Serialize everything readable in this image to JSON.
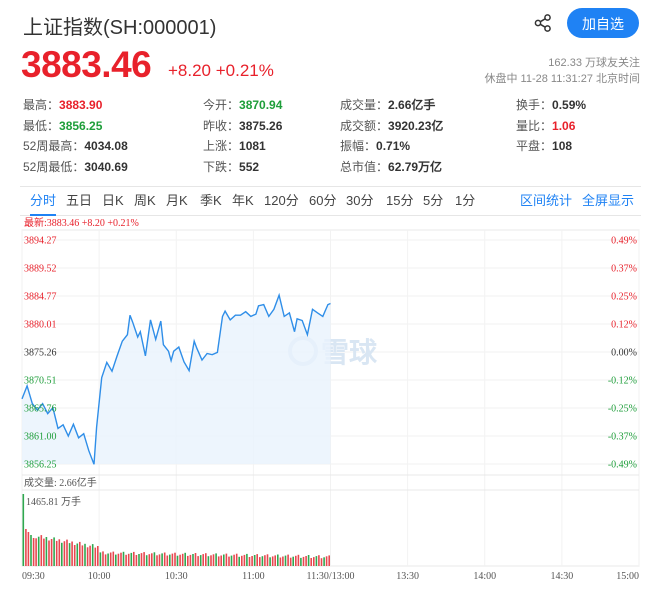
{
  "header": {
    "title": "上证指数(SH:000001)",
    "add_button": "加自选",
    "price": "3883.46",
    "change": "+8.20",
    "change_pct": "+0.21%",
    "followers": "162.33 万球友关注",
    "status": "休盘中 11-28 11:31:27 北京时间"
  },
  "stats": [
    {
      "label": "最高：",
      "value": "3883.90",
      "color": "#e8212b"
    },
    {
      "label": "今开：",
      "value": "3870.94",
      "color": "#1e9e3a"
    },
    {
      "label": "成交量：",
      "value": "2.66亿手",
      "color": "#333333"
    },
    {
      "label": "换手：",
      "value": "0.59%",
      "color": "#333333"
    },
    {
      "label": "最低：",
      "value": "3856.25",
      "color": "#1e9e3a"
    },
    {
      "label": "昨收：",
      "value": "3875.26",
      "color": "#333333"
    },
    {
      "label": "成交额：",
      "value": "3920.23亿",
      "color": "#333333"
    },
    {
      "label": "量比：",
      "value": "1.06",
      "color": "#e8212b"
    },
    {
      "label": "52周最高：",
      "value": "4034.08",
      "color": "#333333"
    },
    {
      "label": "上涨：",
      "value": "1081",
      "color": "#333333"
    },
    {
      "label": "振幅：",
      "value": "0.71%",
      "color": "#333333"
    },
    {
      "label": "平盘：",
      "value": "108",
      "color": "#333333"
    },
    {
      "label": "52周最低：",
      "value": "3040.69",
      "color": "#333333"
    },
    {
      "label": "下跌：",
      "value": "552",
      "color": "#333333"
    },
    {
      "label": "总市值：",
      "value": "62.79万亿",
      "color": "#333333"
    }
  ],
  "tabs": [
    "分时",
    "五日",
    "日K",
    "周K",
    "月K",
    "季K",
    "年K",
    "120分",
    "60分",
    "30分",
    "15分",
    "5分",
    "1分"
  ],
  "active_tab": "分时",
  "tab_links": [
    "区间统计",
    "全屏显示"
  ],
  "chart_data": {
    "type": "line",
    "latest_label": "最新:3883.46 +8.20 +0.21%",
    "volume_label": "成交量: 2.66亿手",
    "volume_max_label": "1465.81 万手",
    "watermark": "雪球",
    "ylim": [
      3856.25,
      3894.27
    ],
    "prev_close": 3875.26,
    "y_ticks": [
      "3894.27",
      "3889.52",
      "3884.77",
      "3880.01",
      "3875.26",
      "3870.51",
      "3865.76",
      "3861.00",
      "3856.25"
    ],
    "pct_ticks": [
      "0.49%",
      "0.37%",
      "0.25%",
      "0.12%",
      "0.00%",
      "-0.12%",
      "-0.25%",
      "-0.37%",
      "-0.49%"
    ],
    "x_ticks": [
      "09:30",
      "10:00",
      "10:30",
      "11:00",
      "11:30/13:00",
      "13:30",
      "14:00",
      "14:30",
      "15:00"
    ],
    "x_minutes": [
      0,
      30,
      60,
      90,
      120,
      150,
      180,
      210,
      240
    ],
    "x_minutes_total": 240,
    "series": [
      {
        "minutes": [
          0,
          2,
          4,
          6,
          8,
          10,
          12,
          14,
          16,
          18,
          20,
          22,
          24,
          26,
          28,
          29,
          31,
          33,
          35,
          37,
          39,
          41,
          42,
          43,
          45,
          46,
          48,
          50,
          52,
          54,
          55,
          57,
          58,
          59,
          61,
          63,
          65,
          67,
          68,
          70,
          72,
          74,
          76,
          78,
          79,
          81,
          83,
          85,
          87,
          89,
          91,
          92,
          94,
          96,
          98,
          100,
          102,
          104,
          106,
          107,
          109,
          111,
          113,
          115,
          117,
          119,
          120
        ],
        "values": [
          3867.3,
          3869.5,
          3866.5,
          3865.4,
          3866.5,
          3864.8,
          3865.8,
          3862.3,
          3862.9,
          3861.0,
          3863.0,
          3860.7,
          3861.4,
          3858.5,
          3856.2,
          3862.5,
          3870.9,
          3873.5,
          3872.0,
          3874.6,
          3877.1,
          3878.2,
          3881.5,
          3880.4,
          3877.8,
          3878.7,
          3874.6,
          3880.7,
          3877.4,
          3880.5,
          3876.5,
          3875.4,
          3873.8,
          3875.4,
          3876.1,
          3873.6,
          3872.1,
          3877.1,
          3875.9,
          3873.9,
          3875.0,
          3874.8,
          3875.2,
          3881.3,
          3882.2,
          3880.7,
          3881.5,
          3881.5,
          3882.1,
          3881.3,
          3881.7,
          3883.1,
          3883.3,
          3881.3,
          3882.5,
          3884.9,
          3881.3,
          3881.9,
          3878.7,
          3880.9,
          3880.6,
          3878.2,
          3882.5,
          3881.9,
          3881.3,
          3883.3,
          3883.5
        ]
      }
    ]
  }
}
